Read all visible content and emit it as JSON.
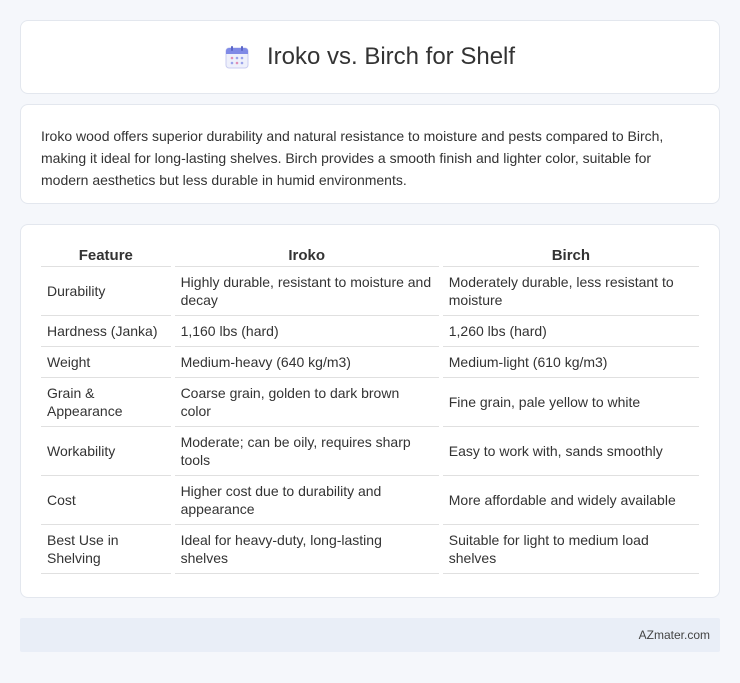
{
  "header": {
    "title": "Iroko vs. Birch for Shelf",
    "icon": "calendar-icon"
  },
  "description": "Iroko wood offers superior durability and natural resistance to moisture and pests compared to Birch, making it ideal for long-lasting shelves. Birch provides a smooth finish and lighter color, suitable for modern aesthetics but less durable in humid environments.",
  "table": {
    "headers": [
      "Feature",
      "Iroko",
      "Birch"
    ],
    "rows": [
      [
        "Durability",
        "Highly durable, resistant to moisture and decay",
        "Moderately durable, less resistant to moisture"
      ],
      [
        "Hardness (Janka)",
        "1,160 lbs (hard)",
        "1,260 lbs (hard)"
      ],
      [
        "Weight",
        "Medium-heavy (640 kg/m3)",
        "Medium-light (610 kg/m3)"
      ],
      [
        "Grain & Appearance",
        "Coarse grain, golden to dark brown color",
        "Fine grain, pale yellow to white"
      ],
      [
        "Workability",
        "Moderate; can be oily, requires sharp tools",
        "Easy to work with, sands smoothly"
      ],
      [
        "Cost",
        "Higher cost due to durability and appearance",
        "More affordable and widely available"
      ],
      [
        "Best Use in Shelving",
        "Ideal for heavy-duty, long-lasting shelves",
        "Suitable for light to medium load shelves"
      ]
    ]
  },
  "footer": {
    "brand": "AZmater.com"
  },
  "colors": {
    "background": "#f5f7fb",
    "card": "#ffffff",
    "footer": "#e9eef7"
  }
}
